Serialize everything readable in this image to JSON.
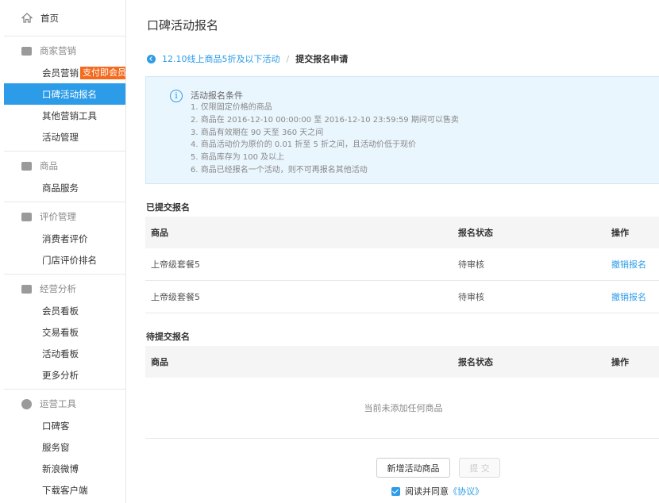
{
  "sidebar": {
    "home": {
      "label": "首页",
      "icon": "home-icon"
    },
    "groups": [
      {
        "title": "商家营销",
        "icon": "marketing-icon",
        "items": [
          {
            "label": "会员营销",
            "badge": "支付即会员"
          },
          {
            "label": "口碑活动报名",
            "active": true
          },
          {
            "label": "其他营销工具"
          },
          {
            "label": "活动管理"
          }
        ]
      },
      {
        "title": "商品",
        "icon": "goods-icon",
        "items": [
          {
            "label": "商品服务"
          }
        ]
      },
      {
        "title": "评价管理",
        "icon": "review-icon",
        "items": [
          {
            "label": "消费者评价"
          },
          {
            "label": "门店评价排名"
          }
        ]
      },
      {
        "title": "经营分析",
        "icon": "analysis-icon",
        "items": [
          {
            "label": "会员看板"
          },
          {
            "label": "交易看板"
          },
          {
            "label": "活动看板"
          },
          {
            "label": "更多分析"
          }
        ]
      },
      {
        "title": "运营工具",
        "icon": "operations-icon",
        "items": [
          {
            "label": "口碑客"
          },
          {
            "label": "服务窗"
          },
          {
            "label": "新浪微博"
          },
          {
            "label": "下载客户端"
          }
        ]
      }
    ]
  },
  "main": {
    "title": "口碑活动报名",
    "breadcrumb": {
      "link": "12.10线上商品5折及以下活动",
      "separator": "/",
      "current": "提交报名申请"
    },
    "notice": {
      "title": "活动报名条件",
      "items": [
        "1. 仅限固定价格的商品",
        "2. 商品在 2016-12-10 00:00:00 至 2016-12-10 23:59:59 期间可以售卖",
        "3. 商品有效期在 90 天至 360 天之间",
        "4. 商品活动价为原价的 0.01 折至 5 折之间，且活动价低于现价",
        "5. 商品库存为 100 及以上",
        "6. 商品已经报名一个活动，则不可再报名其他活动"
      ]
    },
    "submitted": {
      "title": "已提交报名",
      "columns": [
        "商品",
        "报名状态",
        "操作"
      ],
      "rows": [
        {
          "product": "上帝级套餐5",
          "status": "待审核",
          "action": "撤销报名"
        },
        {
          "product": "上帝级套餐5",
          "status": "待审核",
          "action": "撤销报名"
        }
      ]
    },
    "pending": {
      "title": "待提交报名",
      "columns": [
        "商品",
        "报名状态",
        "操作"
      ],
      "empty_text": "当前未添加任何商品"
    },
    "buttons": {
      "add": "新增活动商品",
      "submit": "提 交"
    },
    "agreement": {
      "text": "阅读并同意",
      "link": "《协议》",
      "checked": true
    }
  },
  "colors": {
    "accent": "#2d9ce8",
    "badge": "#f46b1f",
    "notice_bg": "#eaf6fe"
  }
}
